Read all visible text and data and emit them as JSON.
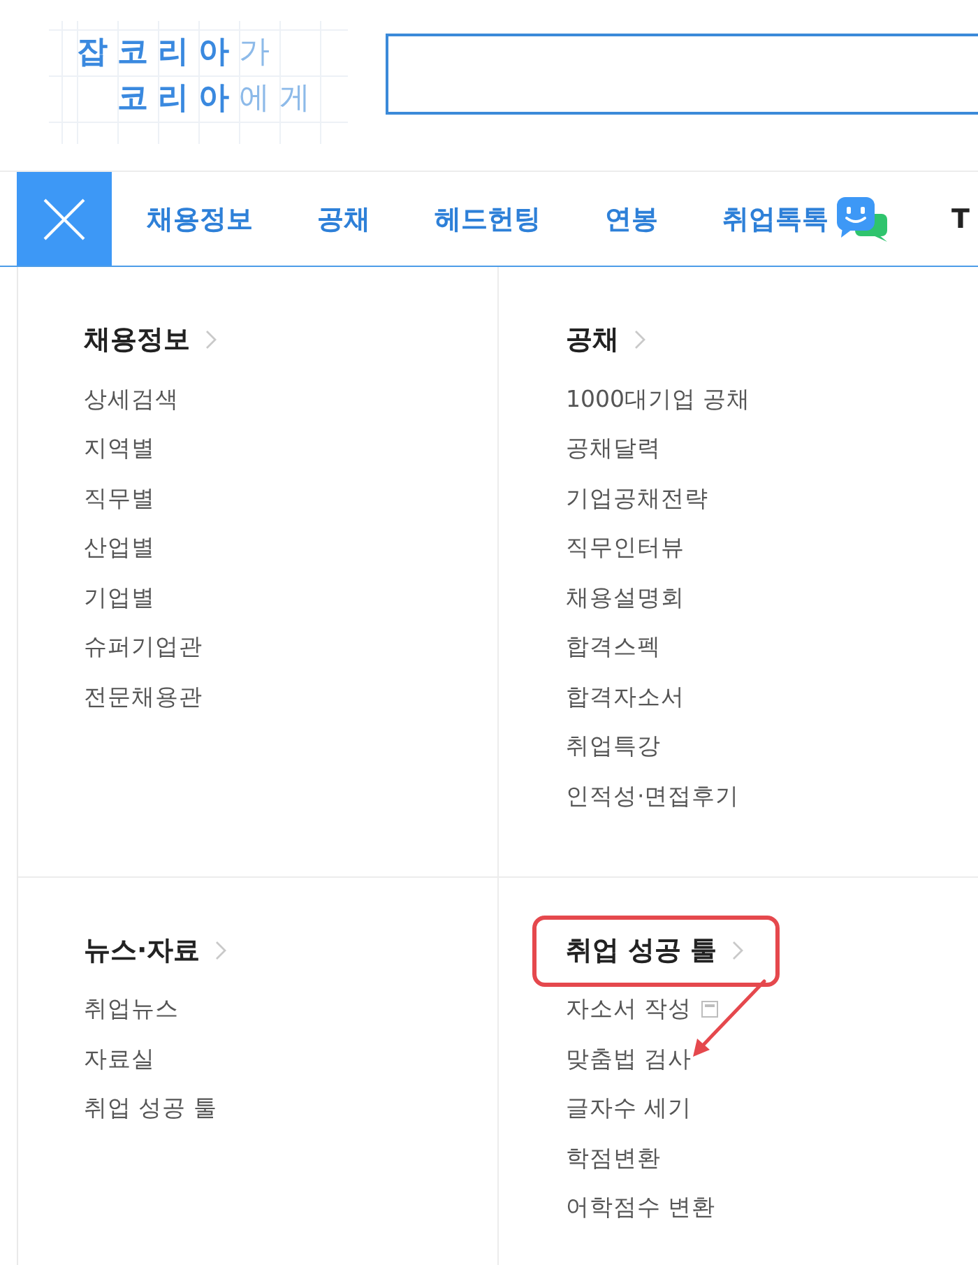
{
  "logo": {
    "lines": [
      "**잡코리아**가",
      "**코리아**에게"
    ]
  },
  "nav": {
    "menu_open": true,
    "items": [
      {
        "label": "채용정보",
        "kind": "link"
      },
      {
        "label": "공채",
        "kind": "link"
      },
      {
        "label": "헤드헌팅",
        "kind": "link"
      },
      {
        "label": "연봉",
        "kind": "link"
      },
      {
        "label": "취업톡톡",
        "kind": "chat"
      },
      {
        "label": "T",
        "kind": "cut"
      }
    ]
  },
  "menu": {
    "rows": [
      {
        "columns": [
          {
            "heading": {
              "label": "채용정보",
              "highlighted": false
            },
            "items": [
              {
                "label": "상세검색"
              },
              {
                "label": "지역별"
              },
              {
                "label": "직무별"
              },
              {
                "label": "산업별"
              },
              {
                "label": "기업별"
              },
              {
                "label": "슈퍼기업관"
              },
              {
                "label": "전문채용관"
              }
            ]
          },
          {
            "heading": {
              "label": "공채",
              "highlighted": false
            },
            "items": [
              {
                "label": "1000대기업 공채"
              },
              {
                "label": "공채달력"
              },
              {
                "label": "기업공채전략"
              },
              {
                "label": "직무인터뷰"
              },
              {
                "label": "채용설명회"
              },
              {
                "label": "합격스펙"
              },
              {
                "label": "합격자소서"
              },
              {
                "label": "취업특강"
              },
              {
                "label": "인적성·면접후기"
              }
            ]
          }
        ]
      },
      {
        "columns": [
          {
            "heading": {
              "label": "뉴스·자료",
              "highlighted": false
            },
            "items": [
              {
                "label": "취업뉴스"
              },
              {
                "label": "자료실"
              },
              {
                "label": "취업 성공 툴"
              }
            ]
          },
          {
            "heading": {
              "label": "취업 성공 툴",
              "highlighted": true
            },
            "items": [
              {
                "label": "자소서 작성",
                "new_window": true,
                "arrow": false
              },
              {
                "label": "맞춤법 검사",
                "new_window": false,
                "arrow": true
              },
              {
                "label": "글자수 세기",
                "new_window": false,
                "arrow": false
              },
              {
                "label": "학점변환",
                "new_window": false,
                "arrow": false
              },
              {
                "label": "어학점수 변환",
                "new_window": false,
                "arrow": false
              }
            ]
          }
        ]
      }
    ]
  }
}
